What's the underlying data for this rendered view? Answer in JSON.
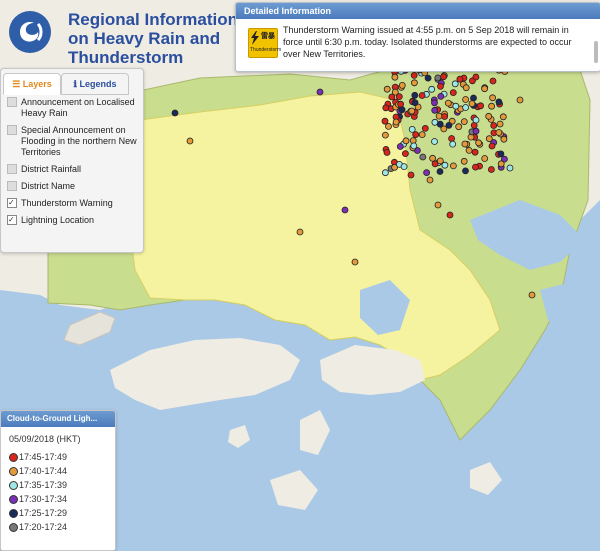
{
  "app": {
    "title": "Regional Information on Heavy Rain and Thunderstorm"
  },
  "detail_panel": {
    "header": "Detailed Information",
    "warning_icon": {
      "name": "thunderstorm-warning-icon",
      "zh": "雷暴",
      "en": "Thunderstorm"
    },
    "text": "Thunderstorm Warning issued at 4:55 p.m. on 5 Sep 2018 will remain in force until 6:30 p.m. today. Isolated thunderstorms are expected to occur over New Territories."
  },
  "layers_panel": {
    "tabs": [
      {
        "label": "☰ Layers",
        "active": true
      },
      {
        "label": "ℹ Legends",
        "active": false
      }
    ],
    "items": [
      {
        "label": "Announcement on Localised Heavy Rain",
        "checked": false
      },
      {
        "label": "Special Announcement on Flooding in the northern New Territories",
        "checked": false
      },
      {
        "label": "District Rainfall",
        "checked": false
      },
      {
        "label": "District Name",
        "checked": false
      },
      {
        "label": "Thunderstorm Warning",
        "checked": true
      },
      {
        "label": "Lightning Location",
        "checked": true
      }
    ]
  },
  "legend_panel": {
    "header": "Cloud-to-Ground Ligh...",
    "date": "05/09/2018 (HKT)",
    "entries": [
      {
        "label": "17:45-17:49",
        "color": "#d7261c"
      },
      {
        "label": "17:40-17:44",
        "color": "#e39a3b"
      },
      {
        "label": "17:35-17:39",
        "color": "#9fe6e6"
      },
      {
        "label": "17:30-17:34",
        "color": "#7b2fb5"
      },
      {
        "label": "17:25-17:29",
        "color": "#1c2a5a"
      },
      {
        "label": "17:20-17:24",
        "color": "#777777"
      }
    ]
  },
  "colors": {
    "water": "#aac9e6",
    "land": "#f0ede4",
    "warning_area": "#f6f3a0",
    "rural_green": "#c9dd8e",
    "title_blue": "#2a4fa0"
  }
}
